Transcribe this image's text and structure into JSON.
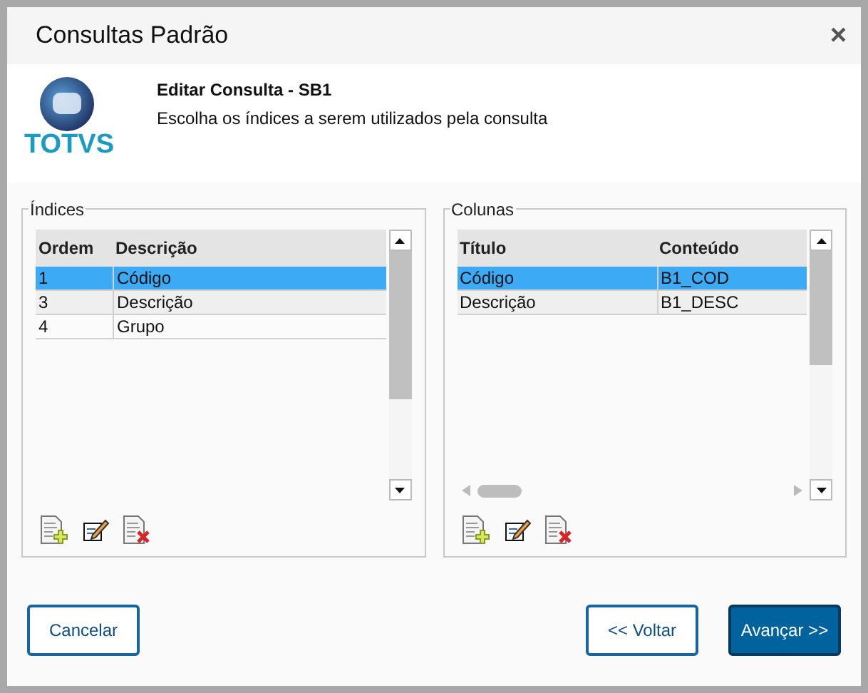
{
  "window": {
    "title": "Consultas Padrão",
    "close": "×"
  },
  "header": {
    "logo_text": "TOTVS",
    "title": "Editar Consulta - SB1",
    "subtitle": "Escolha os índices a serem utilizados pela consulta"
  },
  "panels": [
    {
      "title": "Índices",
      "columns": [
        "Ordem",
        "Descrição"
      ],
      "rows": [
        {
          "cells": [
            "1",
            "Código"
          ],
          "selected": true
        },
        {
          "cells": [
            "3",
            "Descrição"
          ],
          "selected": false
        },
        {
          "cells": [
            "4",
            "Grupo"
          ],
          "selected": false
        }
      ],
      "horizontal_scroll": false
    },
    {
      "title": "Colunas",
      "columns": [
        "Título",
        "Conteúdo"
      ],
      "rows": [
        {
          "cells": [
            "Código",
            "B1_COD"
          ],
          "selected": true
        },
        {
          "cells": [
            "Descrição",
            "B1_DESC"
          ],
          "selected": false
        }
      ],
      "horizontal_scroll": true
    }
  ],
  "buttons": [
    {
      "label": "Cancelar",
      "kind": "secondary"
    },
    {
      "label": "<< Voltar",
      "kind": "secondary"
    },
    {
      "label": "Avançar >>",
      "kind": "primary"
    }
  ]
}
